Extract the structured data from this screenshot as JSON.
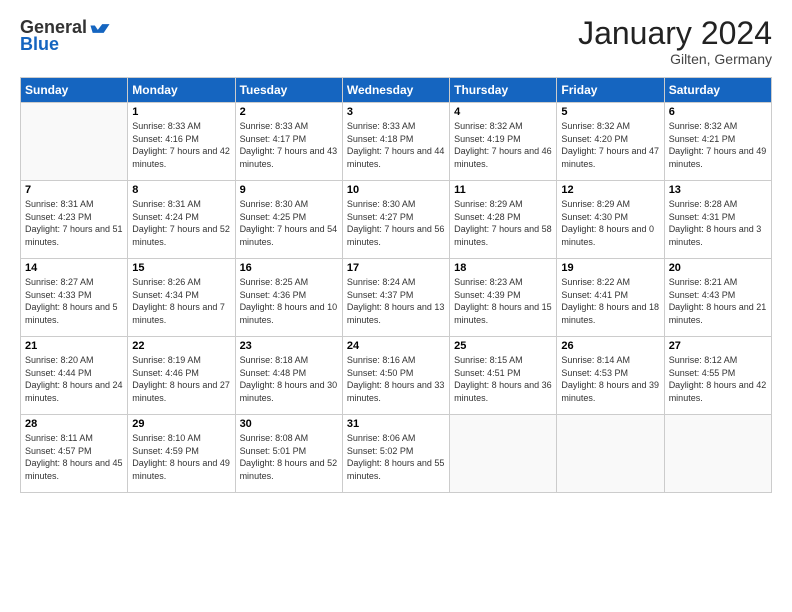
{
  "header": {
    "logo_line1": "General",
    "logo_line2": "Blue",
    "month": "January 2024",
    "location": "Gilten, Germany"
  },
  "days_of_week": [
    "Sunday",
    "Monday",
    "Tuesday",
    "Wednesday",
    "Thursday",
    "Friday",
    "Saturday"
  ],
  "weeks": [
    [
      {
        "num": "",
        "sunrise": "",
        "sunset": "",
        "daylight": ""
      },
      {
        "num": "1",
        "sunrise": "Sunrise: 8:33 AM",
        "sunset": "Sunset: 4:16 PM",
        "daylight": "Daylight: 7 hours and 42 minutes."
      },
      {
        "num": "2",
        "sunrise": "Sunrise: 8:33 AM",
        "sunset": "Sunset: 4:17 PM",
        "daylight": "Daylight: 7 hours and 43 minutes."
      },
      {
        "num": "3",
        "sunrise": "Sunrise: 8:33 AM",
        "sunset": "Sunset: 4:18 PM",
        "daylight": "Daylight: 7 hours and 44 minutes."
      },
      {
        "num": "4",
        "sunrise": "Sunrise: 8:32 AM",
        "sunset": "Sunset: 4:19 PM",
        "daylight": "Daylight: 7 hours and 46 minutes."
      },
      {
        "num": "5",
        "sunrise": "Sunrise: 8:32 AM",
        "sunset": "Sunset: 4:20 PM",
        "daylight": "Daylight: 7 hours and 47 minutes."
      },
      {
        "num": "6",
        "sunrise": "Sunrise: 8:32 AM",
        "sunset": "Sunset: 4:21 PM",
        "daylight": "Daylight: 7 hours and 49 minutes."
      }
    ],
    [
      {
        "num": "7",
        "sunrise": "Sunrise: 8:31 AM",
        "sunset": "Sunset: 4:23 PM",
        "daylight": "Daylight: 7 hours and 51 minutes."
      },
      {
        "num": "8",
        "sunrise": "Sunrise: 8:31 AM",
        "sunset": "Sunset: 4:24 PM",
        "daylight": "Daylight: 7 hours and 52 minutes."
      },
      {
        "num": "9",
        "sunrise": "Sunrise: 8:30 AM",
        "sunset": "Sunset: 4:25 PM",
        "daylight": "Daylight: 7 hours and 54 minutes."
      },
      {
        "num": "10",
        "sunrise": "Sunrise: 8:30 AM",
        "sunset": "Sunset: 4:27 PM",
        "daylight": "Daylight: 7 hours and 56 minutes."
      },
      {
        "num": "11",
        "sunrise": "Sunrise: 8:29 AM",
        "sunset": "Sunset: 4:28 PM",
        "daylight": "Daylight: 7 hours and 58 minutes."
      },
      {
        "num": "12",
        "sunrise": "Sunrise: 8:29 AM",
        "sunset": "Sunset: 4:30 PM",
        "daylight": "Daylight: 8 hours and 0 minutes."
      },
      {
        "num": "13",
        "sunrise": "Sunrise: 8:28 AM",
        "sunset": "Sunset: 4:31 PM",
        "daylight": "Daylight: 8 hours and 3 minutes."
      }
    ],
    [
      {
        "num": "14",
        "sunrise": "Sunrise: 8:27 AM",
        "sunset": "Sunset: 4:33 PM",
        "daylight": "Daylight: 8 hours and 5 minutes."
      },
      {
        "num": "15",
        "sunrise": "Sunrise: 8:26 AM",
        "sunset": "Sunset: 4:34 PM",
        "daylight": "Daylight: 8 hours and 7 minutes."
      },
      {
        "num": "16",
        "sunrise": "Sunrise: 8:25 AM",
        "sunset": "Sunset: 4:36 PM",
        "daylight": "Daylight: 8 hours and 10 minutes."
      },
      {
        "num": "17",
        "sunrise": "Sunrise: 8:24 AM",
        "sunset": "Sunset: 4:37 PM",
        "daylight": "Daylight: 8 hours and 13 minutes."
      },
      {
        "num": "18",
        "sunrise": "Sunrise: 8:23 AM",
        "sunset": "Sunset: 4:39 PM",
        "daylight": "Daylight: 8 hours and 15 minutes."
      },
      {
        "num": "19",
        "sunrise": "Sunrise: 8:22 AM",
        "sunset": "Sunset: 4:41 PM",
        "daylight": "Daylight: 8 hours and 18 minutes."
      },
      {
        "num": "20",
        "sunrise": "Sunrise: 8:21 AM",
        "sunset": "Sunset: 4:43 PM",
        "daylight": "Daylight: 8 hours and 21 minutes."
      }
    ],
    [
      {
        "num": "21",
        "sunrise": "Sunrise: 8:20 AM",
        "sunset": "Sunset: 4:44 PM",
        "daylight": "Daylight: 8 hours and 24 minutes."
      },
      {
        "num": "22",
        "sunrise": "Sunrise: 8:19 AM",
        "sunset": "Sunset: 4:46 PM",
        "daylight": "Daylight: 8 hours and 27 minutes."
      },
      {
        "num": "23",
        "sunrise": "Sunrise: 8:18 AM",
        "sunset": "Sunset: 4:48 PM",
        "daylight": "Daylight: 8 hours and 30 minutes."
      },
      {
        "num": "24",
        "sunrise": "Sunrise: 8:16 AM",
        "sunset": "Sunset: 4:50 PM",
        "daylight": "Daylight: 8 hours and 33 minutes."
      },
      {
        "num": "25",
        "sunrise": "Sunrise: 8:15 AM",
        "sunset": "Sunset: 4:51 PM",
        "daylight": "Daylight: 8 hours and 36 minutes."
      },
      {
        "num": "26",
        "sunrise": "Sunrise: 8:14 AM",
        "sunset": "Sunset: 4:53 PM",
        "daylight": "Daylight: 8 hours and 39 minutes."
      },
      {
        "num": "27",
        "sunrise": "Sunrise: 8:12 AM",
        "sunset": "Sunset: 4:55 PM",
        "daylight": "Daylight: 8 hours and 42 minutes."
      }
    ],
    [
      {
        "num": "28",
        "sunrise": "Sunrise: 8:11 AM",
        "sunset": "Sunset: 4:57 PM",
        "daylight": "Daylight: 8 hours and 45 minutes."
      },
      {
        "num": "29",
        "sunrise": "Sunrise: 8:10 AM",
        "sunset": "Sunset: 4:59 PM",
        "daylight": "Daylight: 8 hours and 49 minutes."
      },
      {
        "num": "30",
        "sunrise": "Sunrise: 8:08 AM",
        "sunset": "Sunset: 5:01 PM",
        "daylight": "Daylight: 8 hours and 52 minutes."
      },
      {
        "num": "31",
        "sunrise": "Sunrise: 8:06 AM",
        "sunset": "Sunset: 5:02 PM",
        "daylight": "Daylight: 8 hours and 55 minutes."
      },
      {
        "num": "",
        "sunrise": "",
        "sunset": "",
        "daylight": ""
      },
      {
        "num": "",
        "sunrise": "",
        "sunset": "",
        "daylight": ""
      },
      {
        "num": "",
        "sunrise": "",
        "sunset": "",
        "daylight": ""
      }
    ]
  ]
}
